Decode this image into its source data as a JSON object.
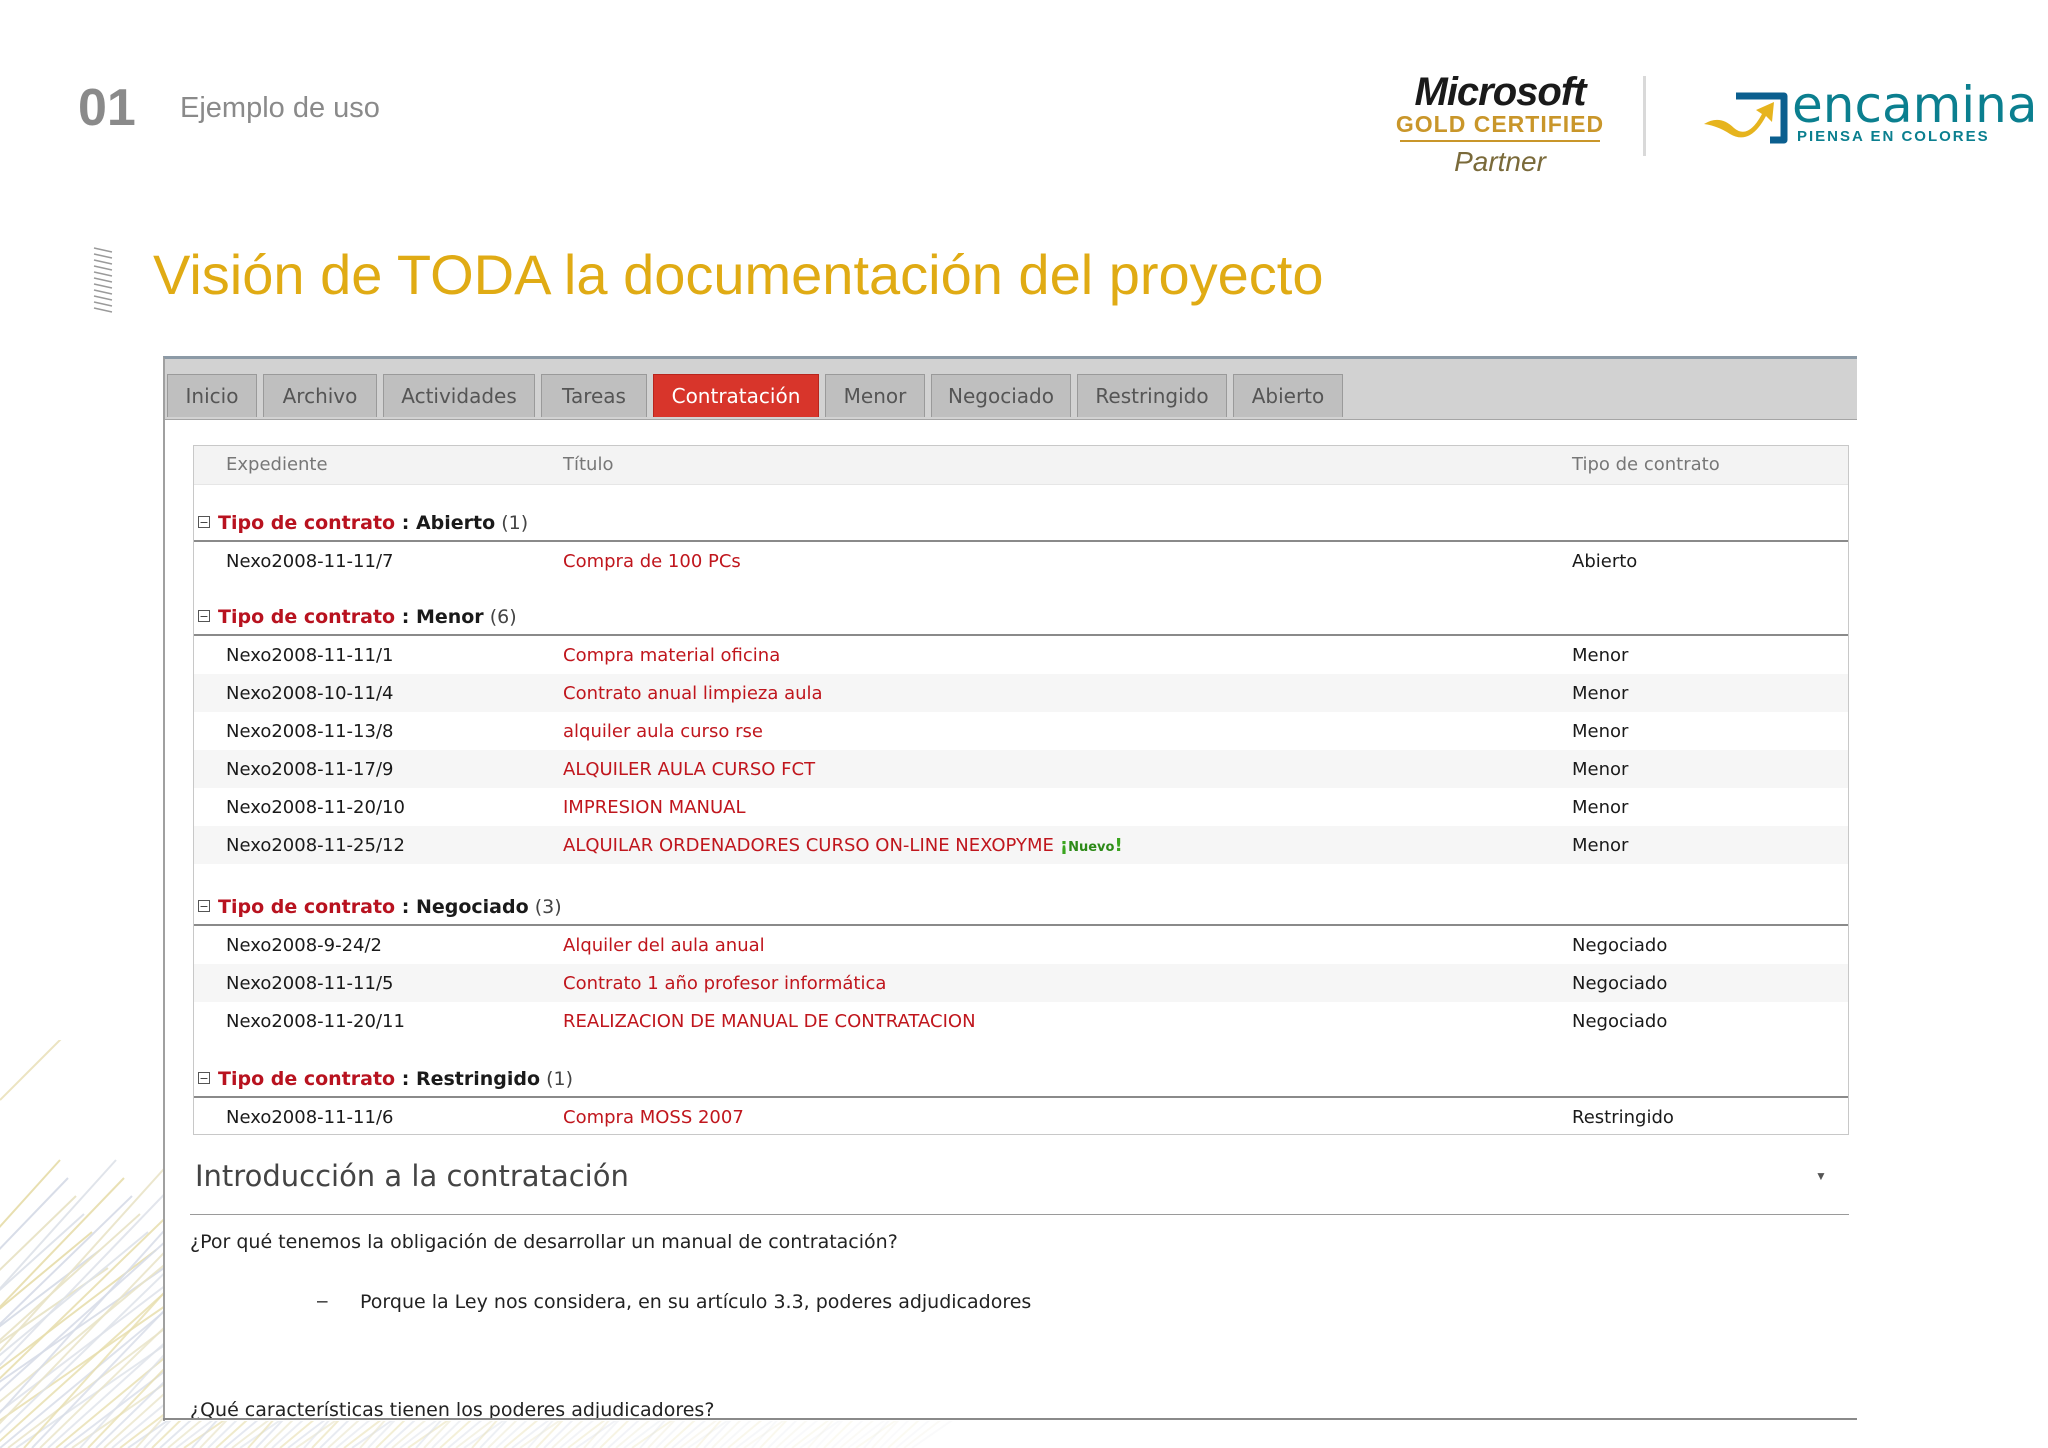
{
  "slide": {
    "number": "01",
    "subtitle": "Ejemplo de uso",
    "title": "Visión de TODA la documentación del proyecto"
  },
  "logos": {
    "microsoft": "Microsoft",
    "gold": "GOLD CERTIFIED",
    "partner": "Partner",
    "encamina": "encamina",
    "encamina_tag": "PIENSA EN COLORES"
  },
  "tabs": [
    {
      "label": "Inicio"
    },
    {
      "label": "Archivo"
    },
    {
      "label": "Actividades"
    },
    {
      "label": "Tareas"
    },
    {
      "label": "Contratación",
      "active": true
    },
    {
      "label": "Menor"
    },
    {
      "label": "Negociado"
    },
    {
      "label": "Restringido"
    },
    {
      "label": "Abierto"
    }
  ],
  "grid": {
    "headers": {
      "expediente": "Expediente",
      "titulo": "Título",
      "tipo": "Tipo de contrato"
    },
    "group_key": "Tipo de contrato",
    "groups": [
      {
        "value": "Abierto",
        "count": "(1)",
        "rows": [
          {
            "expediente": "Nexo2008-11-11/7",
            "titulo": "Compra de 100 PCs",
            "tipo": "Abierto"
          }
        ]
      },
      {
        "value": "Menor",
        "count": "(6)",
        "rows": [
          {
            "expediente": "Nexo2008-11-11/1",
            "titulo": "Compra material oficina",
            "tipo": "Menor"
          },
          {
            "expediente": "Nexo2008-10-11/4",
            "titulo": "Contrato anual limpieza aula",
            "tipo": "Menor"
          },
          {
            "expediente": "Nexo2008-11-13/8",
            "titulo": "alquiler aula curso rse",
            "tipo": "Menor"
          },
          {
            "expediente": "Nexo2008-11-17/9",
            "titulo": "ALQUILER AULA CURSO FCT",
            "tipo": "Menor"
          },
          {
            "expediente": "Nexo2008-11-20/10",
            "titulo": "IMPRESION MANUAL",
            "tipo": "Menor"
          },
          {
            "expediente": "Nexo2008-11-25/12",
            "titulo": "ALQUILAR ORDENADORES CURSO ON-LINE NEXOPYME",
            "tipo": "Menor",
            "badge": "Nuevo"
          }
        ]
      },
      {
        "value": "Negociado",
        "count": "(3)",
        "rows": [
          {
            "expediente": "Nexo2008-9-24/2",
            "titulo": "Alquiler del aula anual",
            "tipo": "Negociado"
          },
          {
            "expediente": "Nexo2008-11-11/5",
            "titulo": "Contrato 1 año profesor informática",
            "tipo": "Negociado"
          },
          {
            "expediente": "Nexo2008-11-20/11",
            "titulo": "REALIZACION DE MANUAL DE CONTRATACION",
            "tipo": "Negociado"
          }
        ]
      },
      {
        "value": "Restringido",
        "count": "(1)",
        "rows": [
          {
            "expediente": "Nexo2008-11-11/6",
            "titulo": "Compra MOSS 2007",
            "tipo": "Restringido"
          }
        ]
      }
    ]
  },
  "intro": {
    "heading": "Introducción a la contratación",
    "q1": "¿Por qué tenemos la obligación de desarrollar un manual de contratación?",
    "bullet1": "Porque la Ley nos considera, en su artículo 3.3, poderes adjudicadores",
    "q2": "¿Qué características tienen los poderes adjudicadores?"
  },
  "colors": {
    "accent": "#e0ab14",
    "active_tab": "#d8352b",
    "link_red": "#c0161d",
    "encamina_teal": "#0b7f8f",
    "ms_gold": "#c9962a"
  }
}
